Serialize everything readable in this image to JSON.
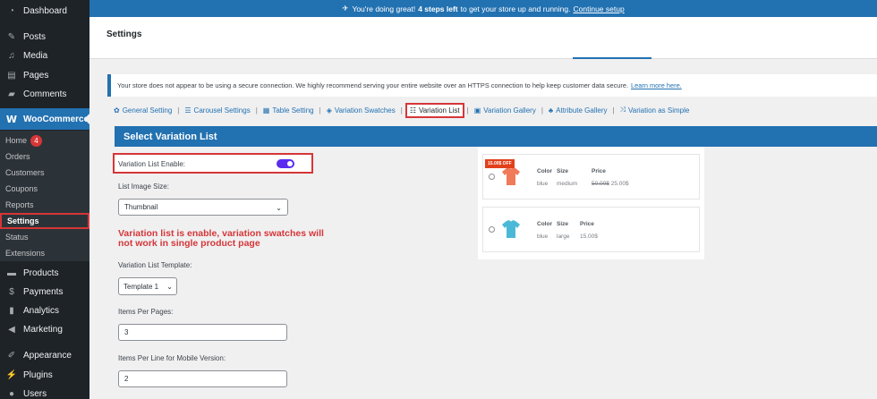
{
  "sidebar": {
    "items": [
      {
        "label": "Dashboard",
        "icon": "dashboard-icon"
      },
      {
        "label": "Posts",
        "icon": "pin-icon"
      },
      {
        "label": "Media",
        "icon": "media-icon"
      },
      {
        "label": "Pages",
        "icon": "page-icon"
      },
      {
        "label": "Comments",
        "icon": "comment-icon"
      },
      {
        "label": "WooCommerce",
        "icon": "woo-icon"
      },
      {
        "label": "Products",
        "icon": "box-icon"
      },
      {
        "label": "Payments",
        "icon": "dollar-icon"
      },
      {
        "label": "Analytics",
        "icon": "bar-chart-icon"
      },
      {
        "label": "Marketing",
        "icon": "megaphone-icon"
      },
      {
        "label": "Appearance",
        "icon": "brush-icon"
      },
      {
        "label": "Plugins",
        "icon": "plug-icon"
      },
      {
        "label": "Users",
        "icon": "user-icon"
      }
    ],
    "woo_submenu": [
      {
        "label": "Home",
        "badge": "4"
      },
      {
        "label": "Orders"
      },
      {
        "label": "Customers"
      },
      {
        "label": "Coupons"
      },
      {
        "label": "Reports"
      },
      {
        "label": "Settings"
      },
      {
        "label": "Status"
      },
      {
        "label": "Extensions"
      }
    ]
  },
  "topnotice": {
    "icon": "rocket-icon",
    "text_pre": "You're doing great!",
    "text_bold": "4 steps left",
    "text_post": "to get your store up and running.",
    "link": "Continue setup"
  },
  "header": {
    "title": "Settings"
  },
  "notice": {
    "text": "Your store does not appear to be using a secure connection. We highly recommend serving your entire website over an HTTPS connection to help keep customer data secure.",
    "link": "Learn more here."
  },
  "plugin_tabs": [
    {
      "label": "General Setting",
      "icon": "gear-icon"
    },
    {
      "label": "Carousel Settings",
      "icon": "carousel-icon"
    },
    {
      "label": "Table Setting",
      "icon": "table-icon"
    },
    {
      "label": "Variation Swatches",
      "icon": "layers-icon"
    },
    {
      "label": "Variation List",
      "icon": "list-icon"
    },
    {
      "label": "Variation Gallery",
      "icon": "gallery-icon"
    },
    {
      "label": "Attribute Gallery",
      "icon": "sitemap-icon"
    },
    {
      "label": "Variation as Simple",
      "icon": "shuffle-icon"
    }
  ],
  "section": {
    "title": "Select Variation List"
  },
  "form": {
    "enable_label": "Variation List Enable:",
    "enable_on": true,
    "image_size_label": "List Image Size:",
    "image_size_value": "Thumbnail",
    "warning": "Variation list is enable, variation swatches will not work in single product page",
    "template_label": "Variation List Template:",
    "template_value": "Template 1",
    "items_per_page_label": "Items Per Pages:",
    "items_per_page_value": "3",
    "items_per_line_label": "Items Per Line for Mobile Version:",
    "items_per_line_value": "2"
  },
  "preview": {
    "headers": {
      "color": "Color",
      "size": "Size",
      "price": "Price"
    },
    "rows": [
      {
        "sale": "15.00$ OFF",
        "color": "blue",
        "size": "medium",
        "old_price": "50.00$",
        "price": "25.00$",
        "shirt_color": "#f07a5a"
      },
      {
        "sale": "",
        "color": "blue",
        "size": "large",
        "old_price": "",
        "price": "15.00$",
        "shirt_color": "#4bb8d8"
      }
    ]
  },
  "colors": {
    "accent": "#2271b1",
    "sidebar": "#1d2327",
    "highlight": "#d63638",
    "toggle": "#5b2bf0"
  }
}
